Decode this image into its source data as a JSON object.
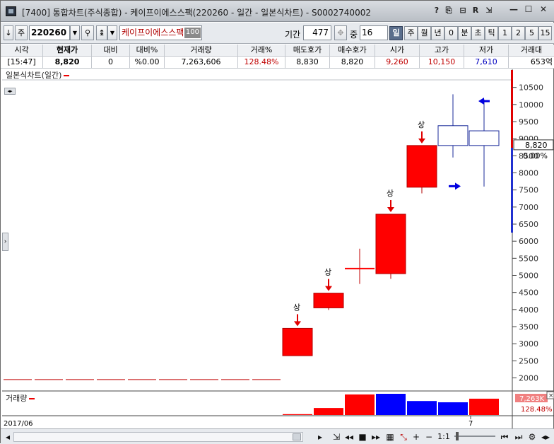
{
  "window": {
    "title": "[7400] 통합차트(주식종합) - 케이프이에스스팩(220260 - 일간 - 일본식차트) - S0002740002",
    "title_buttons": [
      "?",
      "⎘",
      "⊟",
      "R",
      "⇲"
    ],
    "controls": [
      "—",
      "☐",
      "✕"
    ]
  },
  "toolbar": {
    "toggle_label": "↓",
    "type_label": "주",
    "code_value": "220260",
    "name_value": "케이프이에스스팩",
    "name_badge": "100",
    "period_label": "기간",
    "period_value": "477",
    "count_label": "중",
    "count_value": "16",
    "period_buttons": [
      "일",
      "주",
      "월",
      "년",
      "0",
      "분",
      "초",
      "틱",
      "1",
      "2",
      "5",
      "15"
    ],
    "active_period": "일"
  },
  "quote": {
    "headers": [
      "시각",
      "현재가",
      "대비",
      "대비%",
      "거래량",
      "거래%",
      "매도호가",
      "매수호가",
      "시가",
      "고가",
      "저가",
      "거래대"
    ],
    "values": [
      "[15:47]",
      "8,820",
      "0",
      "%0.00",
      "7,263,606",
      "128.48%",
      "8,830",
      "8,820",
      "9,260",
      "10,150",
      "7,610",
      "653억"
    ]
  },
  "chart": {
    "title": "일본식차트(일간)",
    "volume_title": "거래량",
    "date_left": "2017/06",
    "date_tick": "7",
    "current_price_label": "8,820",
    "current_change_label": "0.00%",
    "volume_value_label": "7,263K",
    "volume_pct_label": "128.48%",
    "colors": {
      "up": "#ff0000",
      "down": "#0000ff",
      "neutral": "#000080"
    }
  },
  "chart_data": {
    "type": "candlestick",
    "ylim": [
      1700,
      10700
    ],
    "yticks": [
      2000,
      2500,
      3000,
      3500,
      4000,
      4500,
      5000,
      5500,
      6000,
      6500,
      7000,
      7500,
      8000,
      8500,
      9000,
      9500,
      10000,
      10500
    ],
    "tick_labels": [
      "2000",
      "2500",
      "3000",
      "3500",
      "4000",
      "4500",
      "5000",
      "5500",
      "6000",
      "6500",
      "7000",
      "7500",
      "8000",
      "8500",
      "9000",
      "9500",
      "10000",
      "10500"
    ],
    "flat_line_value": 1950,
    "candles": [
      {
        "open": 2650,
        "close": 3450,
        "high": 3450,
        "low": 2650,
        "style": "up-fill",
        "mark": "상"
      },
      {
        "open": 4050,
        "close": 4480,
        "high": 4480,
        "low": 3990,
        "style": "up-fill",
        "mark": "상"
      },
      {
        "open": 5200,
        "close": 5200,
        "high": 5780,
        "low": 4750,
        "style": "doji",
        "mark": ""
      },
      {
        "open": 5050,
        "close": 6790,
        "high": 6790,
        "low": 4900,
        "style": "up-fill",
        "mark": "상"
      },
      {
        "open": 7580,
        "close": 8800,
        "high": 8800,
        "low": 7400,
        "style": "up-fill",
        "mark": "상"
      },
      {
        "open": 8800,
        "close": 9380,
        "high": 10300,
        "low": 8450,
        "style": "hollow",
        "mark": ""
      },
      {
        "open": 8800,
        "close": 9230,
        "high": 10150,
        "low": 7600,
        "style": "hollow",
        "mark": ""
      }
    ],
    "volume": [
      {
        "value": 0.04,
        "color": "#ff0000"
      },
      {
        "value": 0.33,
        "color": "#ff0000"
      },
      {
        "value": 0.97,
        "color": "#ff0000"
      },
      {
        "value": 1.0,
        "color": "#0000ff"
      },
      {
        "value": 0.66,
        "color": "#0000ff"
      },
      {
        "value": 0.6,
        "color": "#0000ff"
      },
      {
        "value": 0.77,
        "color": "#ff0000"
      }
    ],
    "ylabel": "",
    "xlabel": ""
  },
  "bottom": {
    "zoom_label": "1:1"
  }
}
